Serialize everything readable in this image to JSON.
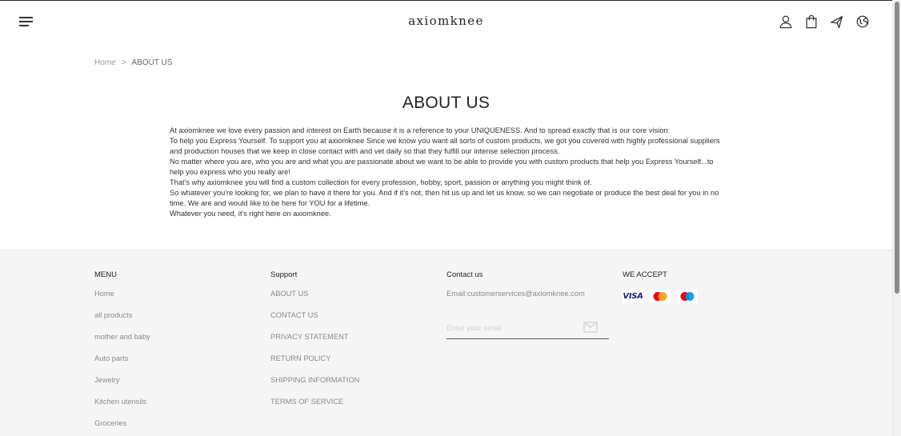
{
  "brand": {
    "name": "axiomknee"
  },
  "header_icons": [
    "account-icon",
    "shopping-bag-icon",
    "shipping-icon",
    "language-globe-icon"
  ],
  "breadcrumb": {
    "home": "Home",
    "separator": ">",
    "current": "ABOUT US"
  },
  "page": {
    "title": "ABOUT US",
    "paragraphs": [
      "At axiomknee we love every passion and interest on Earth because it is a reference to your UNIQUENESS. And to spread exactly that is our core vision:",
      "To help you Express Yourself. To support you at axiomknee Since we know you want all sorts of custom products, we got you covered with highly professional suppliers and production houses that we keep in close contact with and vet daily so that they fulfill our intense selection process.",
      "No matter where you are, who you are and what you are passionate about we want to be able to provide you with custom products that help you Express Yourself...to help you express who you really are!",
      "That's why axiomknee you will find a custom collection for every profession, hobby, sport, passion or anything you might think of.",
      "So whatever you're looking for, we plan to have it there for you. And if it's not, then hit us up and let us know, so we can negotiate or produce the best deal for you in no time. We are and would like to be here for YOU for a lifetime.",
      "Whatever you need, it's right here on axiomknee."
    ]
  },
  "footer": {
    "menu": {
      "title": "MENU",
      "items": [
        "Home",
        "all products",
        "mother and baby",
        "Auto parts",
        "Jewelry",
        "Kitchen utensils",
        "Groceries"
      ]
    },
    "support": {
      "title": "Support",
      "items": [
        "ABOUT US",
        "CONTACT US",
        "PRIVACY STATEMENT",
        "RETURN POLICY",
        "SHIPPING INFORMATION",
        "TERMS OF SERVICE"
      ]
    },
    "contact": {
      "title": "Contact us",
      "email": "Email:customerservices@axiomknee.com",
      "subscribe_placeholder": "Enter your email"
    },
    "accept": {
      "title": "WE ACCEPT",
      "visa_label": "VISA",
      "methods": [
        "visa-icon",
        "mastercard-icon",
        "maestro-icon"
      ]
    }
  }
}
